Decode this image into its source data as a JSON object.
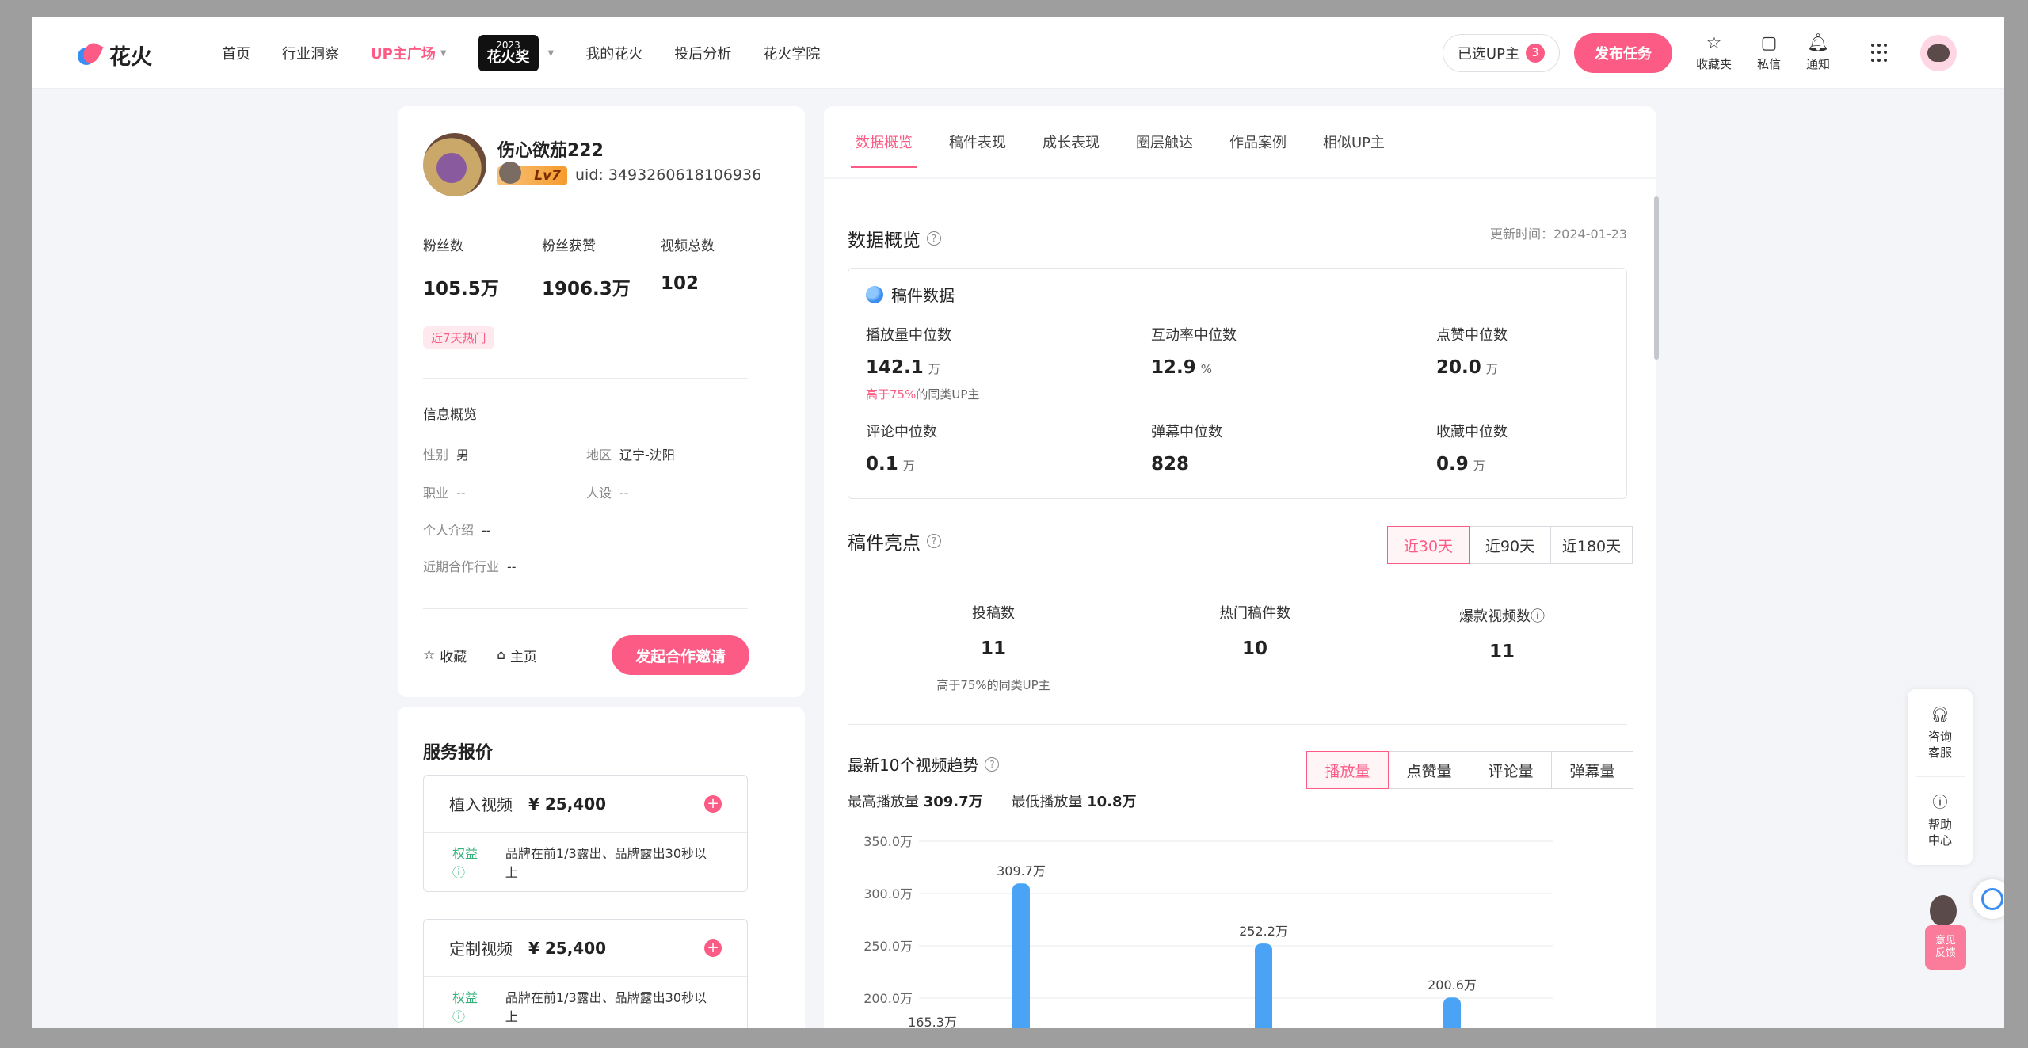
{
  "nav": {
    "logo_text": "花火",
    "items": [
      {
        "label": "首页"
      },
      {
        "label": "行业洞察"
      },
      {
        "label": "UP主广场"
      },
      {
        "label": "我的花火"
      },
      {
        "label": "投后分析"
      },
      {
        "label": "花火学院"
      }
    ],
    "award": {
      "year": "2023",
      "name": "花火奖"
    },
    "selected_up_label": "已选UP主",
    "selected_up_count": "3",
    "publish_label": "发布任务",
    "favorites_label": "收藏夹",
    "messages_label": "私信",
    "notify_label": "通知"
  },
  "profile": {
    "name": "伤心欲茄222",
    "level": "Lv7",
    "uid": "uid: 3493260618106936",
    "stats": [
      {
        "label": "粉丝数",
        "value": "105.5万"
      },
      {
        "label": "粉丝获赞",
        "value": "1906.3万"
      },
      {
        "label": "视频总数",
        "value": "102"
      }
    ],
    "hot_tag": "近7天热门",
    "info_title": "信息概览",
    "gender_label": "性别",
    "gender": "男",
    "region_label": "地区",
    "region": "辽宁-沈阳",
    "job_label": "职业",
    "job": "--",
    "persona_label": "人设",
    "persona": "--",
    "intro_label": "个人介绍",
    "intro": "--",
    "industry_label": "近期合作行业",
    "industry": "--",
    "favorite_label": "收藏",
    "home_label": "主页",
    "invite_label": "发起合作邀请"
  },
  "service": {
    "title": "服务报价",
    "items": [
      {
        "name": "植入视频",
        "price": "¥ 25,400",
        "rights_label": "权益",
        "rights": "品牌在前1/3露出、品牌露出30秒以上"
      },
      {
        "name": "定制视频",
        "price": "¥ 25,400",
        "rights_label": "权益",
        "rights": "品牌在前1/3露出、品牌露出30秒以上"
      }
    ]
  },
  "tabs": [
    {
      "label": "数据概览"
    },
    {
      "label": "稿件表现"
    },
    {
      "label": "成长表现"
    },
    {
      "label": "圈层触达"
    },
    {
      "label": "作品案例"
    },
    {
      "label": "相似UP主"
    }
  ],
  "overview": {
    "title": "数据概览",
    "update_time": "更新时间：2024-01-23",
    "box_title": "稿件数据",
    "metrics": [
      {
        "label": "播放量中位数",
        "value": "142.1",
        "unit": "万",
        "note_highlight": "高于75%",
        "note_rest": "的同类UP主"
      },
      {
        "label": "互动率中位数",
        "value": "12.9",
        "unit": "%"
      },
      {
        "label": "点赞中位数",
        "value": "20.0",
        "unit": "万"
      },
      {
        "label": "评论中位数",
        "value": "0.1",
        "unit": "万"
      },
      {
        "label": "弹幕中位数",
        "value": "828",
        "unit": ""
      },
      {
        "label": "收藏中位数",
        "value": "0.9",
        "unit": "万"
      }
    ]
  },
  "highlights": {
    "title": "稿件亮点",
    "ranges": [
      "近30天",
      "近90天",
      "近180天"
    ],
    "active_range": 0,
    "metrics": [
      {
        "label": "投稿数",
        "value": "11",
        "note": "高于75%的同类UP主"
      },
      {
        "label": "热门稿件数",
        "value": "10"
      },
      {
        "label": "爆款视频数",
        "value": "11"
      }
    ]
  },
  "trend": {
    "title": "最新10个视频趋势",
    "options": [
      "播放量",
      "点赞量",
      "评论量",
      "弹幕量"
    ],
    "active_option": 0,
    "max_label": "最高播放量",
    "max_value": "309.7万",
    "min_label": "最低播放量",
    "min_value": "10.8万"
  },
  "chart_data": {
    "type": "bar",
    "y_ticks": [
      "200.0万",
      "250.0万",
      "300.0万",
      "350.0万"
    ],
    "ylim": [
      150,
      350
    ],
    "unit": "万",
    "visible_bars": [
      {
        "value": 165.3,
        "label": "165.3万"
      },
      {
        "value": 309.7,
        "label": "309.7万"
      },
      {
        "value": 252.2,
        "label": "252.2万"
      },
      {
        "value": 200.6,
        "label": "200.6万"
      }
    ],
    "grid": true,
    "bar_color": "#4aa3f5"
  },
  "side": {
    "consult_label": "咨询客服",
    "help_label": "帮助中心",
    "feedback_label": "意见反馈"
  },
  "colors": {
    "accent": "#fb5b84",
    "blue": "#3b8df2"
  }
}
